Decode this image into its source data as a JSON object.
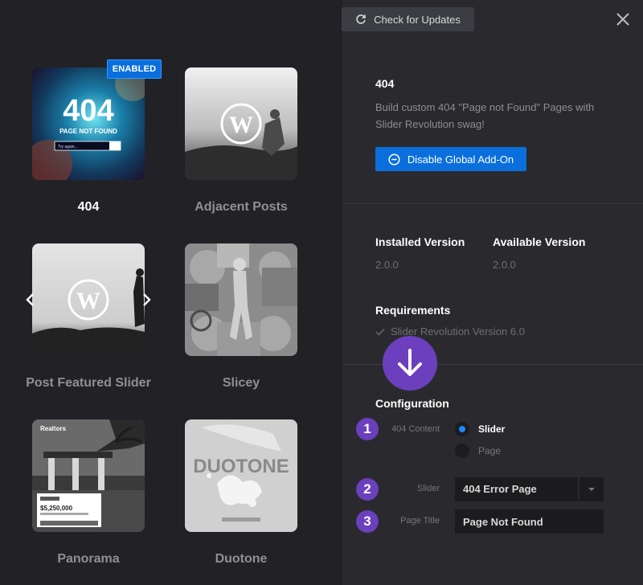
{
  "toolbar": {
    "update_label": "Check for Updates"
  },
  "cards": [
    {
      "label": "404",
      "enabled": true
    },
    {
      "label": "Adjacent Posts"
    },
    {
      "label": "Post Featured Slider"
    },
    {
      "label": "Slicey"
    },
    {
      "label": "Panorama"
    },
    {
      "label": "Duotone"
    }
  ],
  "badge": {
    "label": "ENABLED"
  },
  "thumb_text": {
    "four04_big": "404",
    "four04_sub": "PAGE NOT FOUND",
    "four04_search": "Try again...",
    "panorama_brand": "Realtors",
    "panorama_price": "$5,250,000",
    "duotone_word": "DUOTONE"
  },
  "detail": {
    "title": "404",
    "description": "Build custom 404 \"Page not Found\" Pages with Slider Revolution swag!",
    "disable_label": "Disable Global Add-On",
    "installed_heading": "Installed Version",
    "installed_value": "2.0.0",
    "available_heading": "Available Version",
    "available_value": "2.0.0",
    "requirements_heading": "Requirements",
    "requirement": "Slider Revolution Version 6.0"
  },
  "config": {
    "heading": "Configuration",
    "steps": [
      "1",
      "2",
      "3"
    ],
    "content_label": "404 Content",
    "option_slider": "Slider",
    "option_page": "Page",
    "slider_label": "Slider",
    "slider_value": "404 Error Page",
    "page_title_label": "Page Title",
    "page_title_value": "Page Not Found"
  },
  "colors": {
    "accent_blue": "#0a6fdc",
    "callout_purple": "#6b3fbd",
    "panel_bg": "#2a2a2e",
    "dark_bg": "#222226"
  },
  "icons": [
    "refresh-icon",
    "close-icon",
    "minus-circle-icon",
    "check-icon",
    "arrow-down-icon",
    "chevron-down-icon",
    "wordpress-logo-icon",
    "chevron-left-icon",
    "chevron-right-icon"
  ]
}
